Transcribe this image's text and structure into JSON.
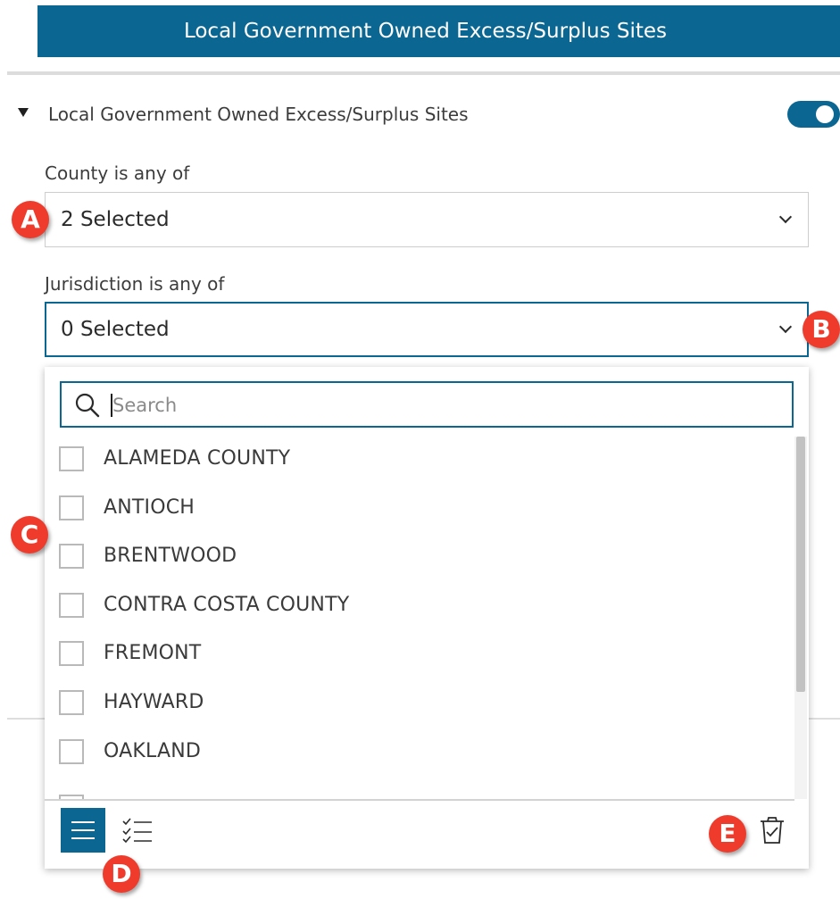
{
  "header": {
    "title": "Local Government Owned Excess/Surplus Sites"
  },
  "layer": {
    "title": "Local Government Owned Excess/Surplus Sites",
    "toggle_on": true
  },
  "filters": {
    "county": {
      "label": "County is any of",
      "value": "2 Selected"
    },
    "jurisdiction": {
      "label": "Jurisdiction is any of",
      "value": "0 Selected"
    }
  },
  "dropdown": {
    "search_placeholder": "Search",
    "items": [
      "ALAMEDA COUNTY",
      "ANTIOCH",
      "BRENTWOOD",
      "CONTRA COSTA COUNTY",
      "FREMONT",
      "HAYWARD",
      "OAKLAND"
    ]
  },
  "callouts": {
    "a": "A",
    "b": "B",
    "c": "C",
    "d": "D",
    "e": "E"
  },
  "colors": {
    "accent": "#0b6792",
    "callout": "#ee3b2c"
  },
  "icons": {
    "search": "search-icon",
    "list_view": "list-view-icon",
    "selected_view": "checklist-icon",
    "clear": "clear-selection-icon",
    "expand": "caret-down-icon",
    "dropdown": "chevron-down-icon"
  }
}
